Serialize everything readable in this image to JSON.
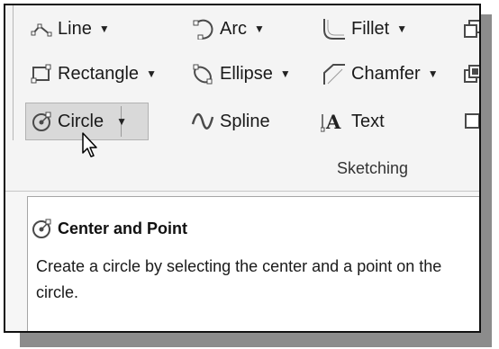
{
  "ribbon": {
    "tools": [
      {
        "id": "line",
        "label": "Line",
        "icon": "line-icon",
        "has_dropdown": true
      },
      {
        "id": "arc",
        "label": "Arc",
        "icon": "arc-icon",
        "has_dropdown": true
      },
      {
        "id": "fillet",
        "label": "Fillet",
        "icon": "fillet-icon",
        "has_dropdown": true
      },
      {
        "id": "rectangle",
        "label": "Rectangle",
        "icon": "rectangle-icon",
        "has_dropdown": true
      },
      {
        "id": "ellipse",
        "label": "Ellipse",
        "icon": "ellipse-icon",
        "has_dropdown": true
      },
      {
        "id": "chamfer",
        "label": "Chamfer",
        "icon": "chamfer-icon",
        "has_dropdown": true
      },
      {
        "id": "circle",
        "label": "Circle",
        "icon": "circle-icon",
        "has_dropdown": true,
        "state": "hovered"
      },
      {
        "id": "spline",
        "label": "Spline",
        "icon": "spline-icon",
        "has_dropdown": false
      },
      {
        "id": "text",
        "label": "Text",
        "icon": "text-icon",
        "has_dropdown": false
      }
    ],
    "dropdown_glyph": "▼",
    "group_label": "Sketching"
  },
  "tooltip": {
    "title": "Center and Point",
    "icon": "circle-center-point-icon",
    "description": "Create a circle by selecting the center and a point on the circle."
  },
  "colors": {
    "ribbon_bg": "#f4f4f4",
    "hover_bg": "#d9d9d9",
    "tooltip_bg": "#ffffff",
    "text": "#1a1a1a"
  }
}
